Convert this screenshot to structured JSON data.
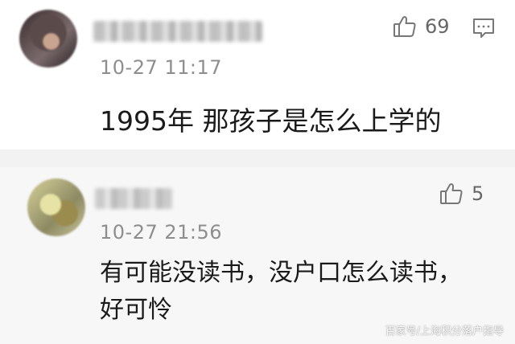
{
  "comments": [
    {
      "timestamp": "10-27 11:17",
      "content": "1995年 那孩子是怎么上学的",
      "likes": "69"
    },
    {
      "timestamp": "10-27 21:56",
      "content_line1": "有可能没读书，没户口怎么读书，",
      "content_line2": "好可怜",
      "likes": "5"
    }
  ],
  "icons": {
    "like": "thumbs-up-icon",
    "reply": "comment-icon"
  },
  "watermark": "百家号/上海积分落户指导"
}
